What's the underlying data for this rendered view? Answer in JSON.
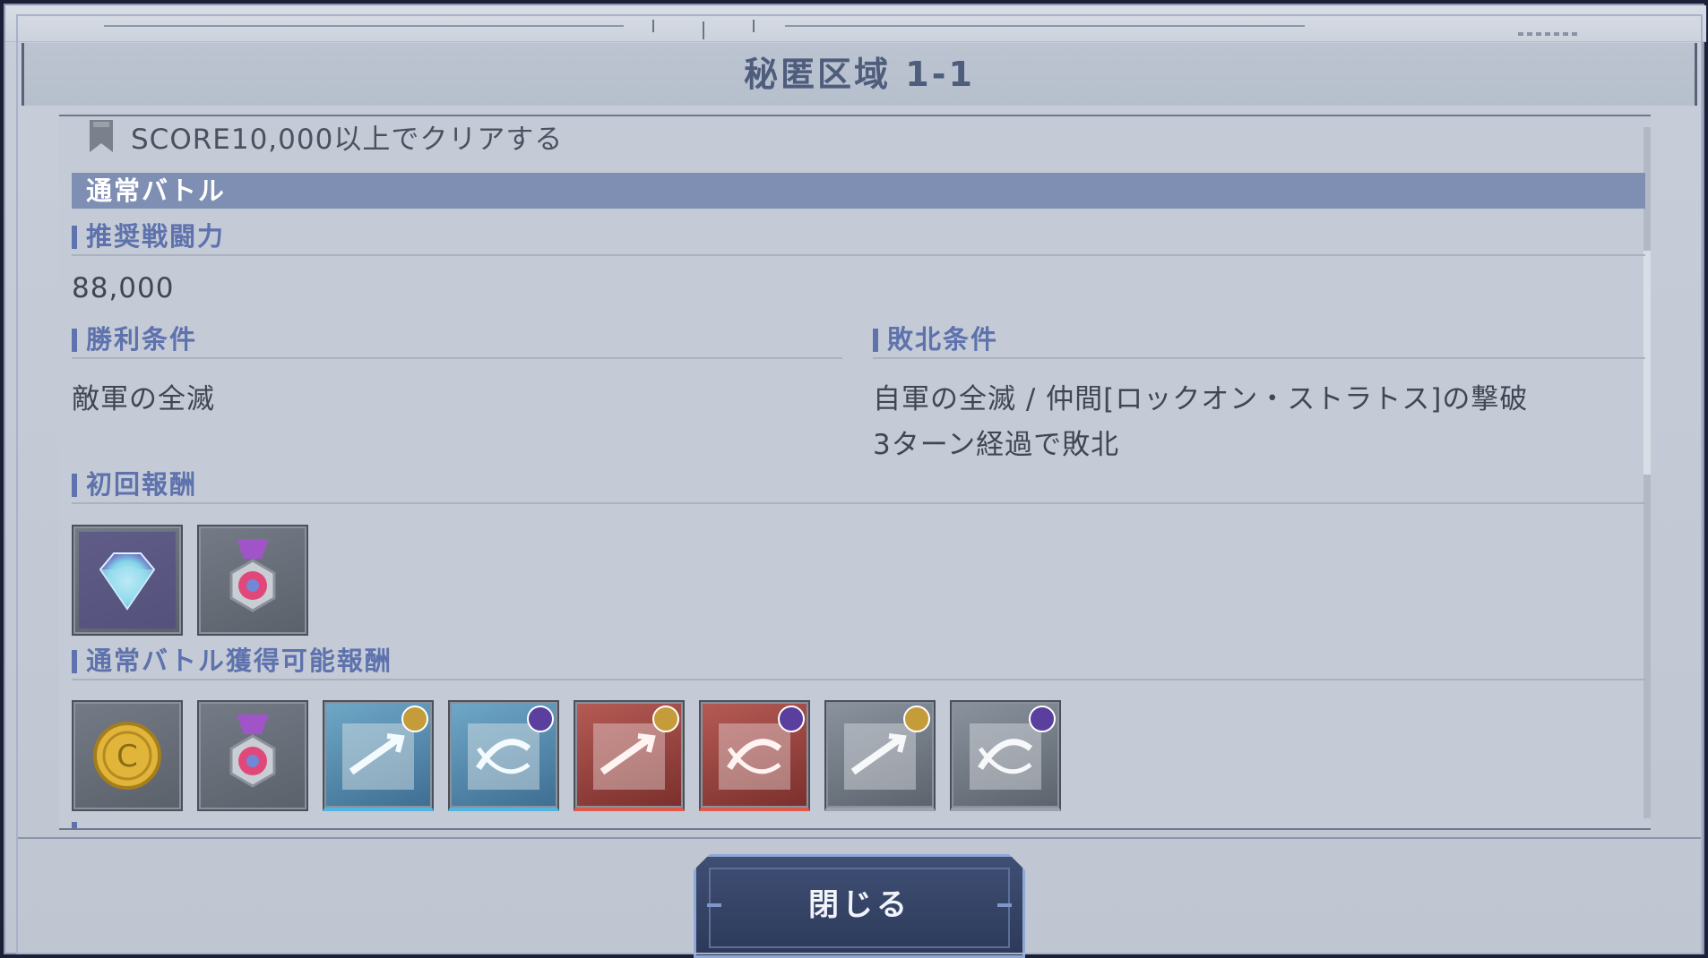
{
  "title": "秘匿区域 1-1",
  "mission": {
    "text": "SCORE10,000以上でクリアする",
    "icon": "ribbon-icon"
  },
  "section": {
    "label": "通常バトル"
  },
  "recommended_power": {
    "label": "推奨戦闘力",
    "value": "88,000"
  },
  "victory": {
    "label": "勝利条件",
    "text": "敵軍の全滅"
  },
  "defeat": {
    "label": "敗北条件",
    "line1": "自軍の全滅 / 仲間[ロックオン・ストラトス]の撃破",
    "line2": "3ターン経過で敗北"
  },
  "first_reward": {
    "label": "初回報酬",
    "items": [
      "diamond-icon",
      "medal-icon"
    ]
  },
  "normal_reward": {
    "label": "通常バトル獲得可能報酬",
    "items": [
      "coin-icon",
      "medal-icon",
      "blue-part-gold-icon",
      "blue-part-purple-icon",
      "red-part-gold-icon",
      "red-part-purple-icon",
      "grey-part-gold-icon",
      "grey-part-purple-icon"
    ]
  },
  "close_button": {
    "label": "閉じる"
  },
  "colors": {
    "accent": "#5e72ad",
    "section_bar": "#7f8fb4",
    "button": "#2c3959"
  }
}
